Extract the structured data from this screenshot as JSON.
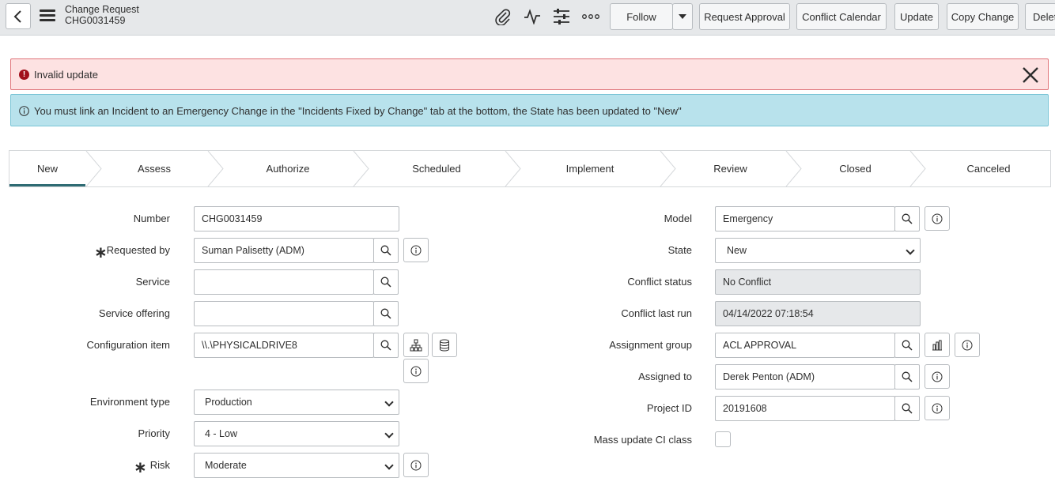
{
  "header": {
    "title": "Change Request",
    "number": "CHG0031459",
    "buttons": {
      "follow": "Follow",
      "request_approval": "Request Approval",
      "conflict_calendar": "Conflict Calendar",
      "update": "Update",
      "copy_change": "Copy Change",
      "delete": "Delete"
    }
  },
  "alerts": {
    "error": "Invalid update",
    "info": "You must link an Incident to an Emergency Change in the \"Incidents Fixed by Change\" tab at the bottom, the State has been updated to \"New\""
  },
  "process_flow": {
    "stages": [
      "New",
      "Assess",
      "Authorize",
      "Scheduled",
      "Implement",
      "Review",
      "Closed",
      "Canceled"
    ],
    "active": "New"
  },
  "form": {
    "left": {
      "number": {
        "label": "Number",
        "value": "CHG0031459"
      },
      "requested_by": {
        "label": "Requested by",
        "value": "Suman Palisetty (ADM)"
      },
      "service": {
        "label": "Service",
        "value": ""
      },
      "service_offering": {
        "label": "Service offering",
        "value": ""
      },
      "configuration_item": {
        "label": "Configuration item",
        "value": "\\\\.\\PHYSICALDRIVE8"
      },
      "environment_type": {
        "label": "Environment type",
        "value": "Production"
      },
      "priority": {
        "label": "Priority",
        "value": "4 - Low"
      },
      "risk": {
        "label": "Risk",
        "value": "Moderate"
      }
    },
    "right": {
      "model": {
        "label": "Model",
        "value": "Emergency"
      },
      "state": {
        "label": "State",
        "value": "New"
      },
      "conflict_status": {
        "label": "Conflict status",
        "value": "No Conflict"
      },
      "conflict_last_run": {
        "label": "Conflict last run",
        "value": "04/14/2022 07:18:54"
      },
      "assignment_group": {
        "label": "Assignment group",
        "value": "ACL APPROVAL"
      },
      "assigned_to": {
        "label": "Assigned to",
        "value": "Derek Penton (ADM)"
      },
      "project_id": {
        "label": "Project ID",
        "value": "20191608"
      },
      "mass_update_ci_class": {
        "label": "Mass update CI class",
        "checked": false
      }
    }
  },
  "colors": {
    "header_bg": "#e6e8ea",
    "error_bg": "#fde2e2",
    "info_bg": "#b8e2ec",
    "active_stage": "#2e6b73"
  }
}
